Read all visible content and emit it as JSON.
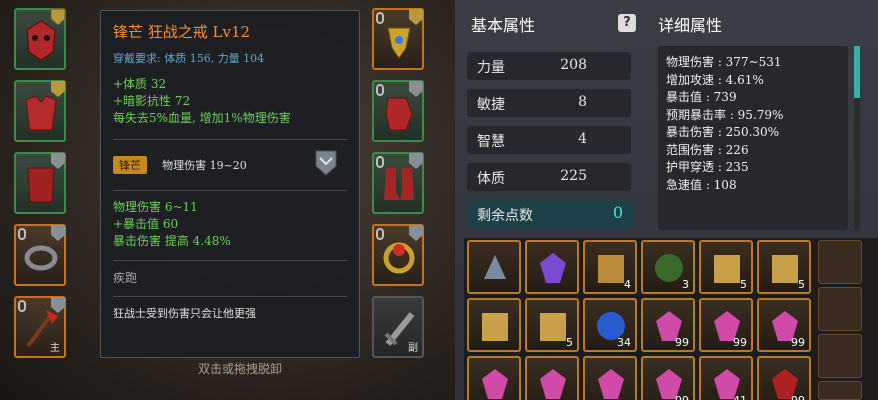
{
  "tooltip": {
    "title": "锋芒  狂战之戒  Lv12",
    "requirement": "穿戴要求:   体质 156, 力量 104",
    "bonus_lines": [
      "+体质 32",
      "+暗影抗性 72",
      "每失去5%血量, 增加1%物理伤害"
    ],
    "badge": "锋芒",
    "badge_text": "物理伤害 19~20",
    "main_stats": [
      "物理伤害  6~11",
      "+暴击值  60",
      "暴击伤害  提高  4.48%"
    ],
    "skill_name": "疾跑",
    "skill_desc": "狂战士受到伤害只会让他更强"
  },
  "hint": "双击或拖拽脱卸",
  "equip_labels": {
    "weapon": "主",
    "offhand": "副"
  },
  "basic": {
    "title": "基本属性",
    "rows": [
      {
        "label": "力量",
        "value": "208"
      },
      {
        "label": "敏捷",
        "value": "8"
      },
      {
        "label": "智慧",
        "value": "4"
      },
      {
        "label": "体质",
        "value": "225"
      }
    ],
    "free_label": "剩余点数",
    "free_value": "0"
  },
  "detail": {
    "title": "详细属性",
    "lines": [
      "物理伤害 : 377~531",
      "增加攻速 : 4.61%",
      "暴击值 : 739",
      "预期暴击率 : 95.79%",
      "暴击伤害 : 250.30%",
      "范围伤害 : 226",
      "护甲穿透 : 235",
      "急速值 : 108"
    ]
  },
  "inventory_counts": [
    "",
    "",
    "4",
    "3",
    "5",
    "5",
    "",
    "5",
    "34",
    "99",
    "99",
    "99",
    "",
    "",
    "",
    "99",
    "41",
    "99"
  ],
  "colors": {
    "accent_orange": "#ff8a2a",
    "stat_green": "#6ecf5a",
    "teal": "#54e0e0"
  }
}
